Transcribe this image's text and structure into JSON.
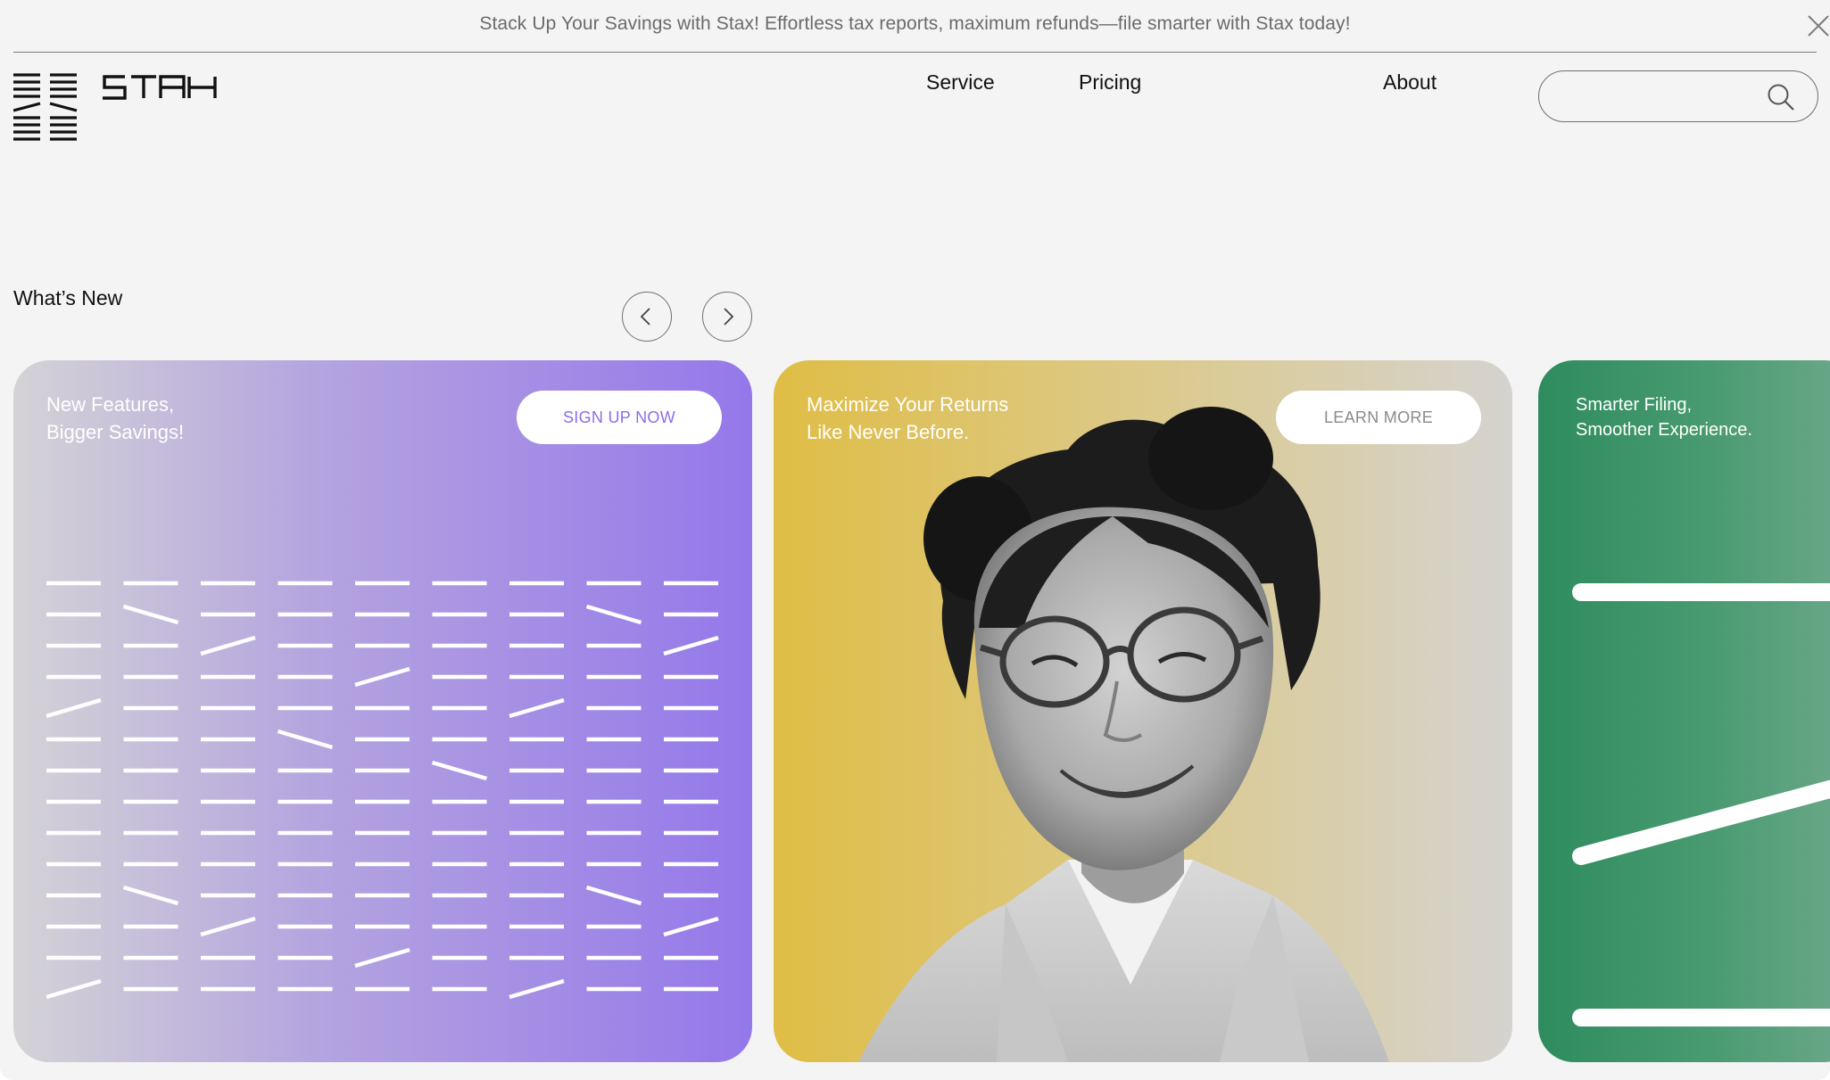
{
  "banner": {
    "text": "Stack Up Your Savings with Stax! Effortless tax reports, maximum refunds—file smarter with Stax today!",
    "close_icon": "close-icon"
  },
  "header": {
    "logo_icon": "stax-logo",
    "nav": [
      {
        "label": "Service"
      },
      {
        "label": "Pricing"
      },
      {
        "label": "About"
      }
    ],
    "search": {
      "value": "",
      "placeholder": "",
      "icon": "search-icon"
    }
  },
  "whats_new": {
    "title": "What’s New",
    "prev_icon": "chevron-left-icon",
    "next_icon": "chevron-right-icon",
    "cards": [
      {
        "text": "New Features,\nBigger Savings!",
        "button": "SIGN UP NOW",
        "accent": "#9478ea"
      },
      {
        "text": "Maximize Your Returns\nLike Never Before.",
        "button": "LEARN MORE",
        "accent": "#dfbd45"
      },
      {
        "text": "Smarter Filing,\nSmoother Experience.",
        "accent": "#2e8c5e"
      }
    ]
  }
}
